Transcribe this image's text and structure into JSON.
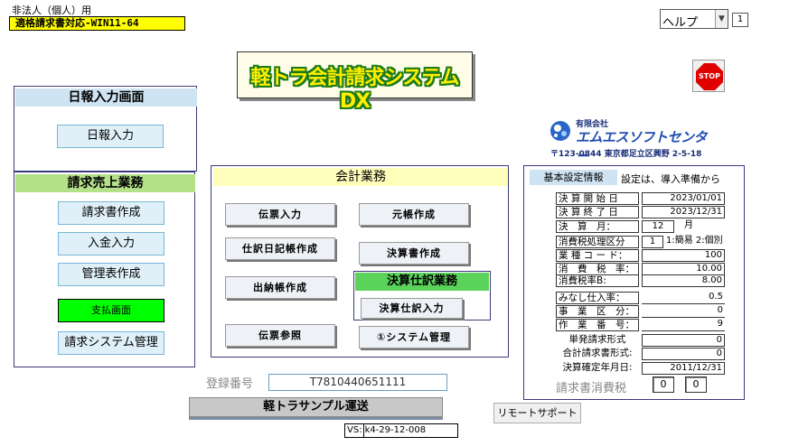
{
  "header": {
    "user_type": "非法人（個人）用",
    "edition": "適格請求書対応-WIN11-64"
  },
  "help": {
    "select_value": "ヘルプ",
    "page_number": "1"
  },
  "app_title": "軽トラ会計請求システムDX",
  "stop_label": "STOP",
  "daily_panel": {
    "title": "日報入力画面",
    "input_button": "日報入力"
  },
  "billing_panel": {
    "title": "請求売上業務",
    "buttons": {
      "invoice": "請求書作成",
      "payment": "入金入力",
      "management": "管理表作成",
      "disbursement": "支払画面",
      "system": "請求システム管理"
    }
  },
  "accounting_panel": {
    "title": "会計業務",
    "buttons": {
      "voucher_input": "伝票入力",
      "journal": "仕訳日記帳作成",
      "cashbook": "出納帳作成",
      "voucher_ref": "伝票参照",
      "ledger": "元帳作成",
      "statements": "決算書作成",
      "system_mgmt": "①システム管理"
    },
    "closing": {
      "title": "決算仕訳業務",
      "button": "決算仕訳入力"
    }
  },
  "registration": {
    "label": "登録番号",
    "value": "T7810440651111"
  },
  "company_name": "軽トラサンプル運送",
  "version": {
    "label": "VS:",
    "value": "k4-29-12-008"
  },
  "remote_support": "リモートサポート",
  "logo": {
    "company_type": "有限会社",
    "company_name": "エムエスソフトセンター",
    "address": "〒123-0844 東京都足立区興野 2-5-18"
  },
  "settings": {
    "title": "基本設定情報",
    "note": "設定は、導入準備から",
    "start_label": "決 算 開 始 日",
    "start_value": "2023/01/01",
    "end_label": "決 算 終 了 日",
    "end_value": "2023/12/31",
    "month_label": "決　算　月：",
    "month_value": "12",
    "month_unit": "月",
    "tax_class_label": "消費税処理区分",
    "tax_class_value": "1",
    "tax_class_options": "1:簡易 2:個別",
    "industry_label": "業 種 コ ー ド：",
    "industry_value": "100",
    "tax_rate_label": "消　費　税　率：",
    "tax_rate_value": "10.00",
    "tax_rate_b_label": "消費税率B:",
    "tax_rate_b_value": "8.00",
    "deemed_label": "みなし仕入率：",
    "deemed_value": "0.5",
    "biz_class_label": "事　業　区　分：",
    "biz_class_value": "0",
    "work_no_label": "作　業　番　号：",
    "work_no_value": "9",
    "single_inv_label": "単発請求形式",
    "single_inv_value": "0",
    "total_inv_label": "合計請求書形式:",
    "total_inv_value": "0",
    "closing_date_label": "決算確定年月日:",
    "closing_date_value": "2011/12/31",
    "invoice_tax_label": "請求書消費税",
    "invoice_tax_values": [
      "0",
      "0"
    ]
  },
  "colors": {
    "title_fill": "#ffee00",
    "title_outline": "#1b7a1b",
    "daily_header": "#cfe4f2",
    "billing_header": "#b4e08a",
    "accounting_header": "#fffebb",
    "closing_header": "#5bd35b",
    "disbursement_button": "#00ff00",
    "edition_badge": "#ffff00"
  }
}
